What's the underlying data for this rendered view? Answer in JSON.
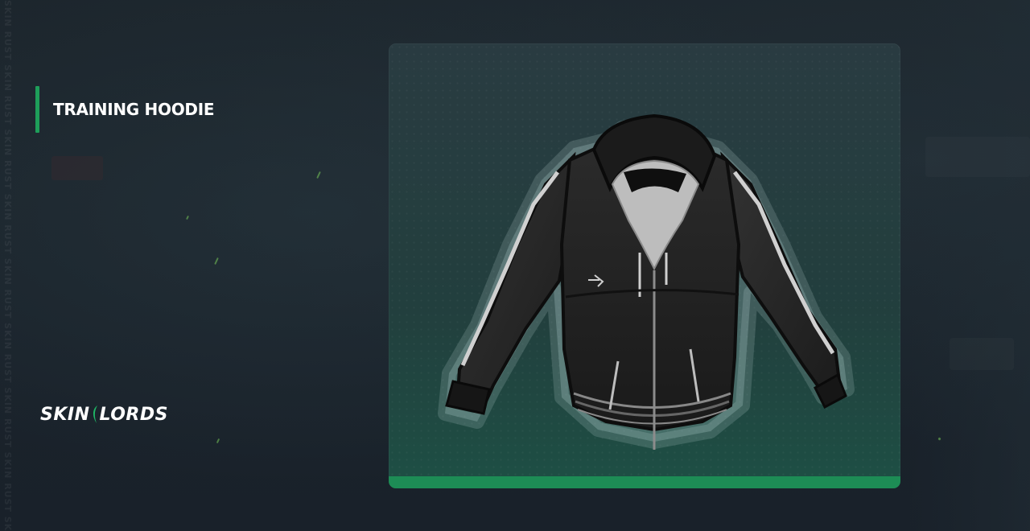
{
  "item": {
    "title": "TRAINING HOODIE"
  },
  "brand": {
    "name_left": "SKIN",
    "name_right": "LORDS"
  },
  "watermark": {
    "text": "SKIN RUST SKIN RUST SKIN RUST SKIN RUST SKIN RUST SKIN RUST SKIN RUST SKIN RUST SKIN RUST"
  },
  "colors": {
    "accent": "#1e9e5a",
    "background": "#1a2229",
    "card_bottom_bar": "#1d8c55"
  },
  "icons": {
    "product_image": "hoodie-icon",
    "brand_mark": "crescent-icon"
  }
}
